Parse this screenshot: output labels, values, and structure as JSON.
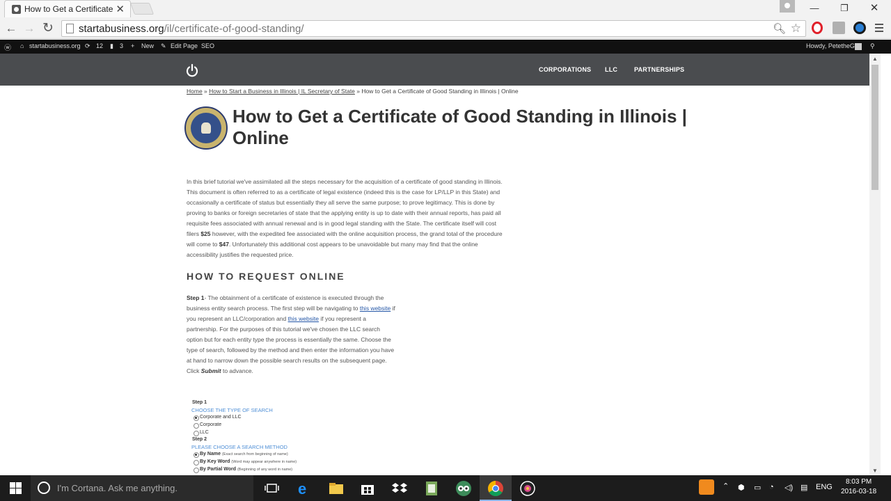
{
  "browser": {
    "tab_title": "How to Get a Certificate o",
    "tab_close": "✕",
    "url_domain": "startabusiness.org",
    "url_path": "/il/certificate-of-good-standing/",
    "window_minimize": "—",
    "window_restore": "❐",
    "window_close": "✕",
    "back": "←",
    "forward": "→",
    "reload": "↻"
  },
  "adminbar": {
    "site": "startabusiness.org",
    "updates": "12",
    "comments": "3",
    "new": "New",
    "edit_page": "Edit Page",
    "seo": "SEO",
    "howdy": "Howdy, PetetheG"
  },
  "site_nav": {
    "items": [
      "CORPORATIONS",
      "LLC",
      "PARTNERSHIPS"
    ]
  },
  "breadcrumb": {
    "home": "Home",
    "sep1": " » ",
    "parent": "How to Start a Business in Illinois | IL Secretary of State",
    "sep2": " » ",
    "current": "How to Get a Certificate of Good Standing in Illinois | Online"
  },
  "page": {
    "title": "How to Get a Certificate of Good Standing in Illinois | Online",
    "intro_1": "In this brief tutorial we've assimilated all the steps necessary for the acquisition of a certificate of good standing in Illinois. This document is often referred to as a certificate of legal existence (indeed this is the case for LP/LLP in this State) and occasionally a certificate of status but essentially they all serve the same purpose; to prove legitimacy. This is done by proving to banks or foreign secretaries of state that the applying entity is up to date with their annual reports, has paid all requisite fees associated with annual renewal and is in good legal standing with the State. The certificate itself will cost filers ",
    "intro_price1": "$25",
    "intro_2": " however, with the expedited fee associated with the online acquisition process, the grand total of the procedure will come to ",
    "intro_price2": "$47",
    "intro_3": ". Unfortunately this additional cost appears to be unavoidable but many may find that the online accessibility justifies the requested price.",
    "section_heading": "HOW TO REQUEST ONLINE",
    "step1_label": "Step 1",
    "step1_a": "- The obtainment of a certificate of existence is executed through the business entity search process. The first step will be navigating to ",
    "link1": "this website",
    "step1_b": " if you represent an LLC/corporation and ",
    "link2": "this website",
    "step1_c": " if you represent a partnership. For the purposes of this tutorial we've chosen the LLC search option but for each entity type the process is essentially the same. Choose the type of search, followed by the method and then enter the information you have at hand to narrow down the possible search results on the subsequent page. Click ",
    "submit_word": "Submit",
    "step1_d": " to advance."
  },
  "form_screenshot": {
    "step1": "Step 1",
    "choose_type": "CHOOSE THE TYPE OF SEARCH",
    "types": [
      "Corporate and LLC",
      "Corporate",
      "LLC"
    ],
    "step2": "Step 2",
    "choose_method": "PLEASE CHOOSE A SEARCH METHOD",
    "methods": [
      {
        "label": "By Name",
        "hint": "(Exact search from beginning of name)"
      },
      {
        "label": "By Key Word",
        "hint": "(Word may appear anywhere in name)"
      },
      {
        "label": "By Partial Word",
        "hint": "(Beginning of any word in name)"
      }
    ]
  },
  "taskbar": {
    "cortana": "I'm Cortana. Ask me anything.",
    "lang": "ENG",
    "time": "8:03 PM",
    "date": "2016-03-18"
  }
}
